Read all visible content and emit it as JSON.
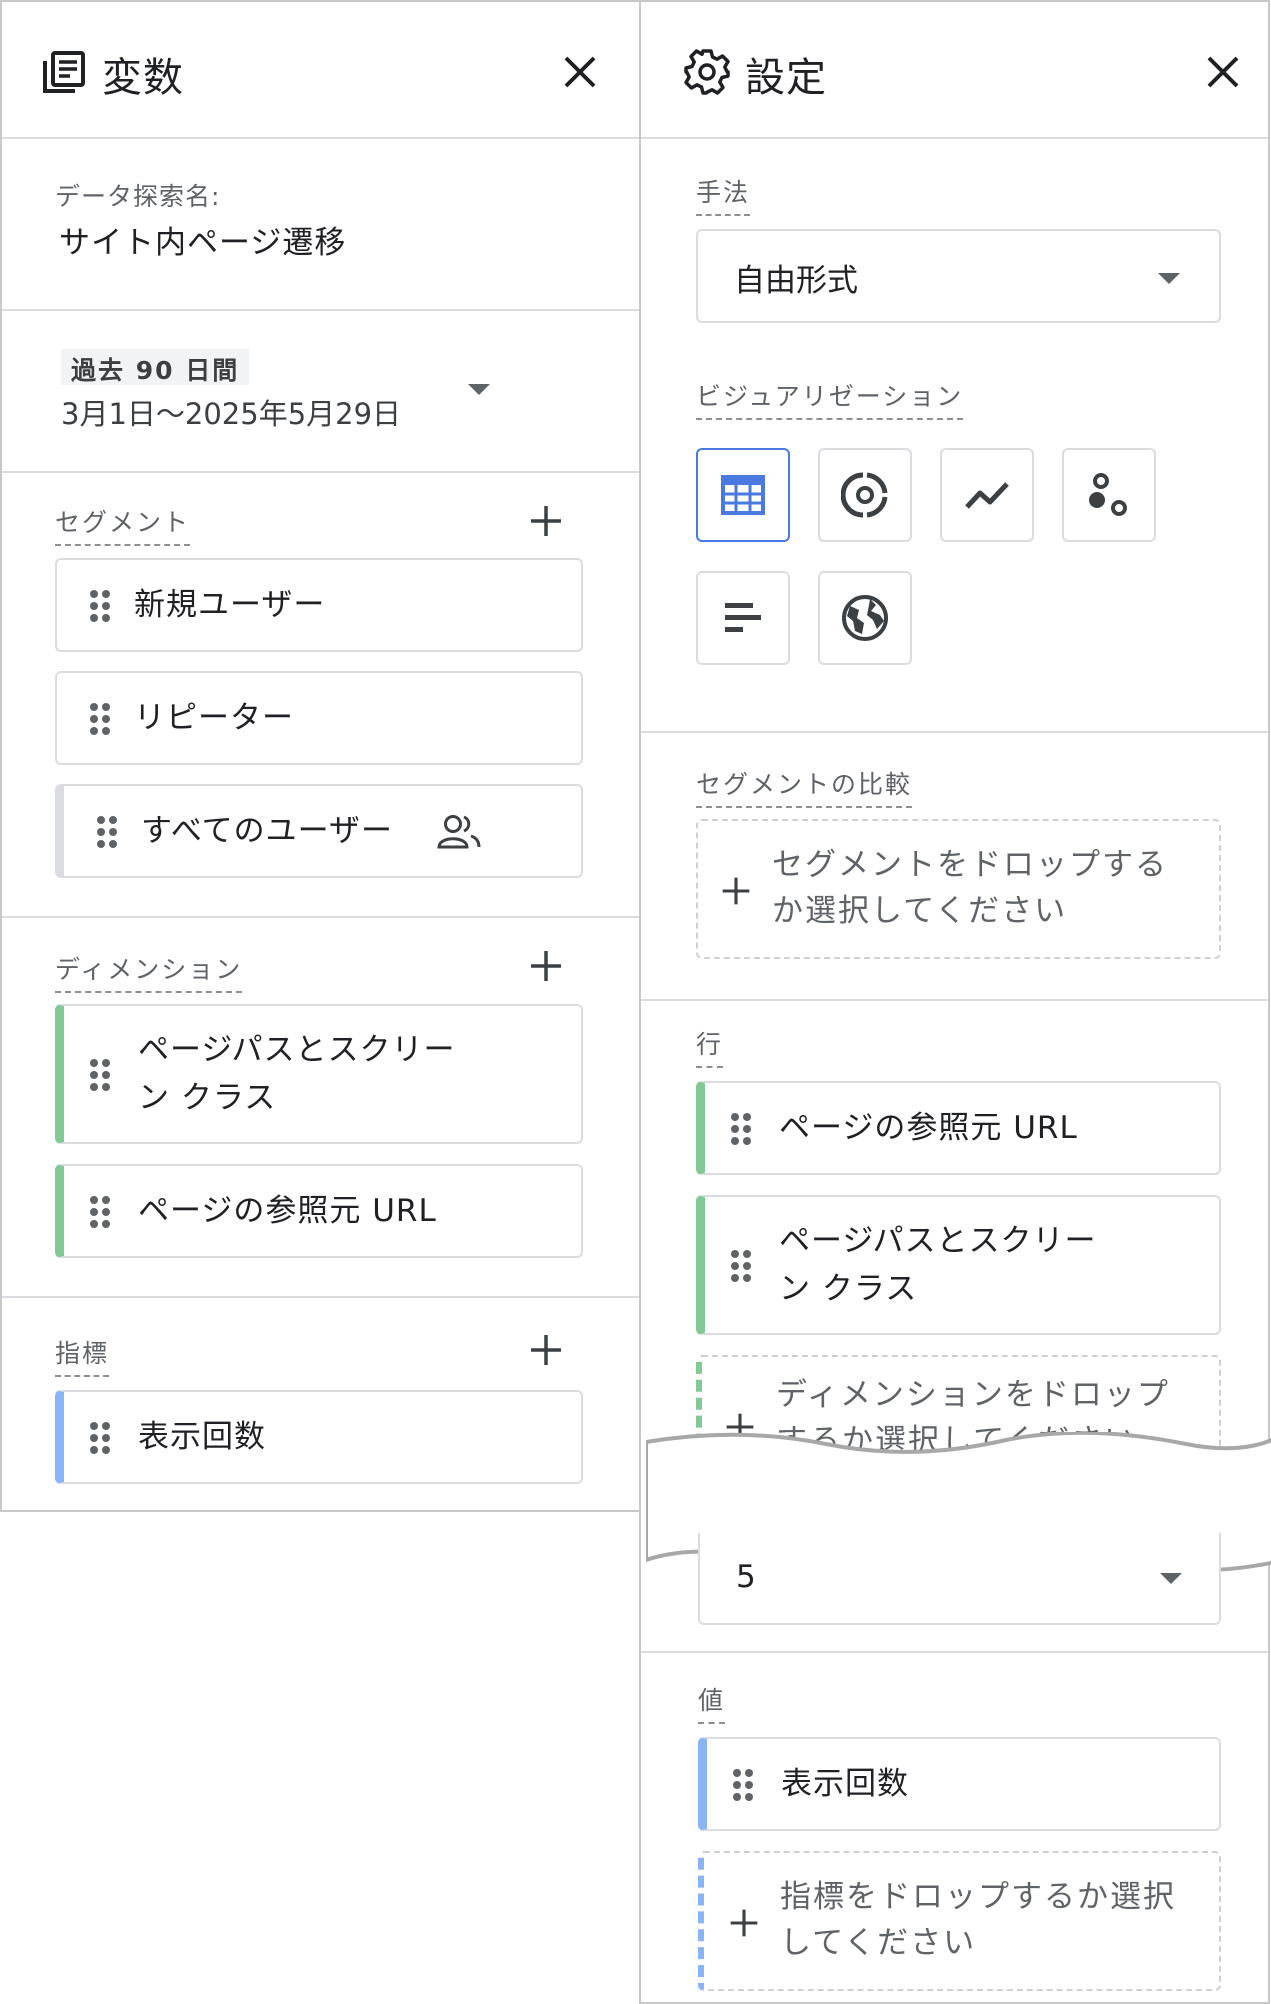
{
  "variables_panel": {
    "title": "変数",
    "icon": "document-list-icon",
    "exploration": {
      "label": "データ探索名:",
      "name": "サイト内ページ遷移"
    },
    "date_range": {
      "badge": "過去 90 日間",
      "range": "3月1日〜2025年5月29日"
    },
    "segments": {
      "label": "セグメント",
      "items": [
        {
          "label": "新規ユーザー"
        },
        {
          "label": "リピーター"
        },
        {
          "label": "すべてのユーザー",
          "icon": "people-icon"
        }
      ]
    },
    "dimensions": {
      "label": "ディメンション",
      "items": [
        {
          "line1": "ページパスとスクリー",
          "line2": "ン クラス"
        },
        {
          "label": "ページの参照元 URL"
        }
      ]
    },
    "metrics": {
      "label": "指標",
      "items": [
        {
          "label": "表示回数"
        }
      ]
    }
  },
  "settings_panel": {
    "title": "設定",
    "icon": "gear-icon",
    "technique": {
      "label": "手法",
      "value": "自由形式"
    },
    "visualization": {
      "label": "ビジュアリゼーション",
      "options": [
        "table-icon",
        "donut-chart-icon",
        "line-chart-icon",
        "scatter-plot-icon",
        "bar-chart-icon",
        "globe-icon"
      ],
      "selected": "table-icon"
    },
    "segment_compare": {
      "label": "セグメントの比較",
      "drop_line1": "セグメントをドロップする",
      "drop_line2": "か選択してください"
    },
    "rows": {
      "label": "行",
      "items": [
        {
          "label": "ページの参照元 URL"
        },
        {
          "line1": "ページパスとスクリー",
          "line2": "ン クラス"
        }
      ],
      "drop_text": "ディメンションをドロップ",
      "drop_text_partial": "するか選択してください",
      "rows_select_value": "5"
    },
    "values": {
      "label": "値",
      "items": [
        {
          "label": "表示回数"
        }
      ],
      "drop_line1": "指標をドロップするか選択",
      "drop_line2": "してください"
    }
  },
  "colors": {
    "dimension_accent": "#81c995",
    "metric_accent": "#8ab4f8",
    "segment_accent": "#dadce0",
    "selected_border": "#4a7ae0"
  }
}
